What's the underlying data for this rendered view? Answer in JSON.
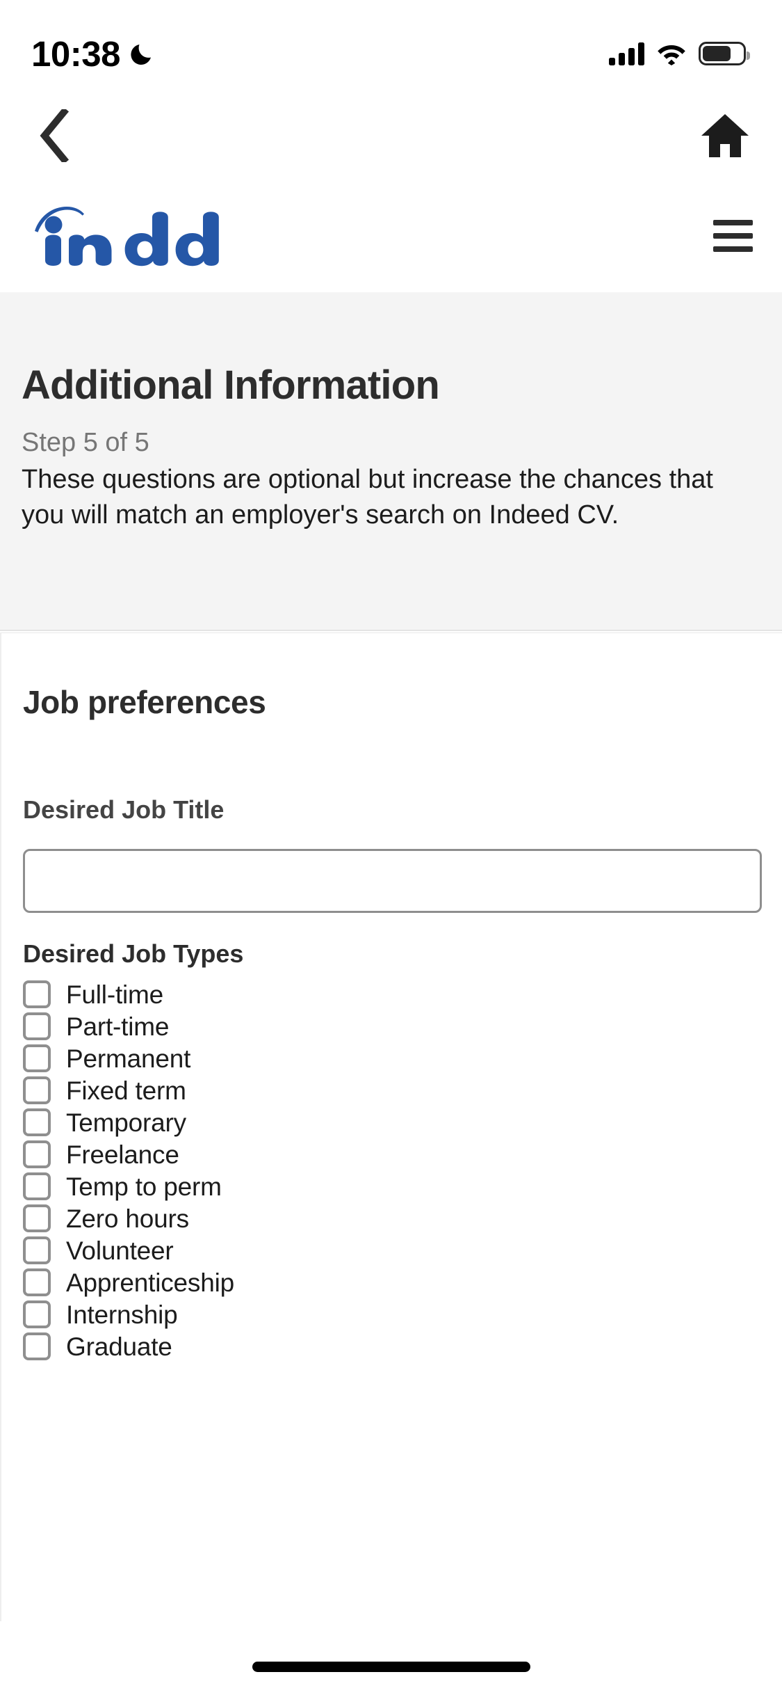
{
  "status_bar": {
    "time": "10:38",
    "dnd_icon": "crescent-moon-icon",
    "signal_icon": "cellular-signal-icon",
    "signal_bars": 4,
    "wifi_icon": "wifi-icon",
    "battery_icon": "battery-icon",
    "battery_level_percent": 72
  },
  "browser_nav": {
    "back_icon": "chevron-left-icon",
    "home_icon": "home-icon"
  },
  "site_header": {
    "logo_text": "indeed",
    "logo_color": "#2557a7",
    "menu_icon": "hamburger-menu-icon"
  },
  "hero": {
    "title": "Additional Information",
    "step": "Step 5 of 5",
    "description": "These questions are optional but increase the chances that you will match an employer's search on Indeed CV.",
    "background_color": "#f4f4f4",
    "title_color": "#2d2d2d",
    "step_color": "#767676"
  },
  "form": {
    "section_title": "Job preferences",
    "job_title_field": {
      "label": "Desired Job Title",
      "value": "",
      "placeholder": ""
    },
    "job_types": {
      "label": "Desired Job Types",
      "options": [
        {
          "label": "Full-time",
          "checked": false
        },
        {
          "label": "Part-time",
          "checked": false
        },
        {
          "label": "Permanent",
          "checked": false
        },
        {
          "label": "Fixed term",
          "checked": false
        },
        {
          "label": "Temporary",
          "checked": false
        },
        {
          "label": "Freelance",
          "checked": false
        },
        {
          "label": "Temp to perm",
          "checked": false
        },
        {
          "label": "Zero hours",
          "checked": false
        },
        {
          "label": "Volunteer",
          "checked": false
        },
        {
          "label": "Apprenticeship",
          "checked": false
        },
        {
          "label": "Internship",
          "checked": false
        },
        {
          "label": "Graduate",
          "checked": false
        }
      ]
    }
  },
  "system": {
    "home_indicator": "home-indicator-bar"
  }
}
